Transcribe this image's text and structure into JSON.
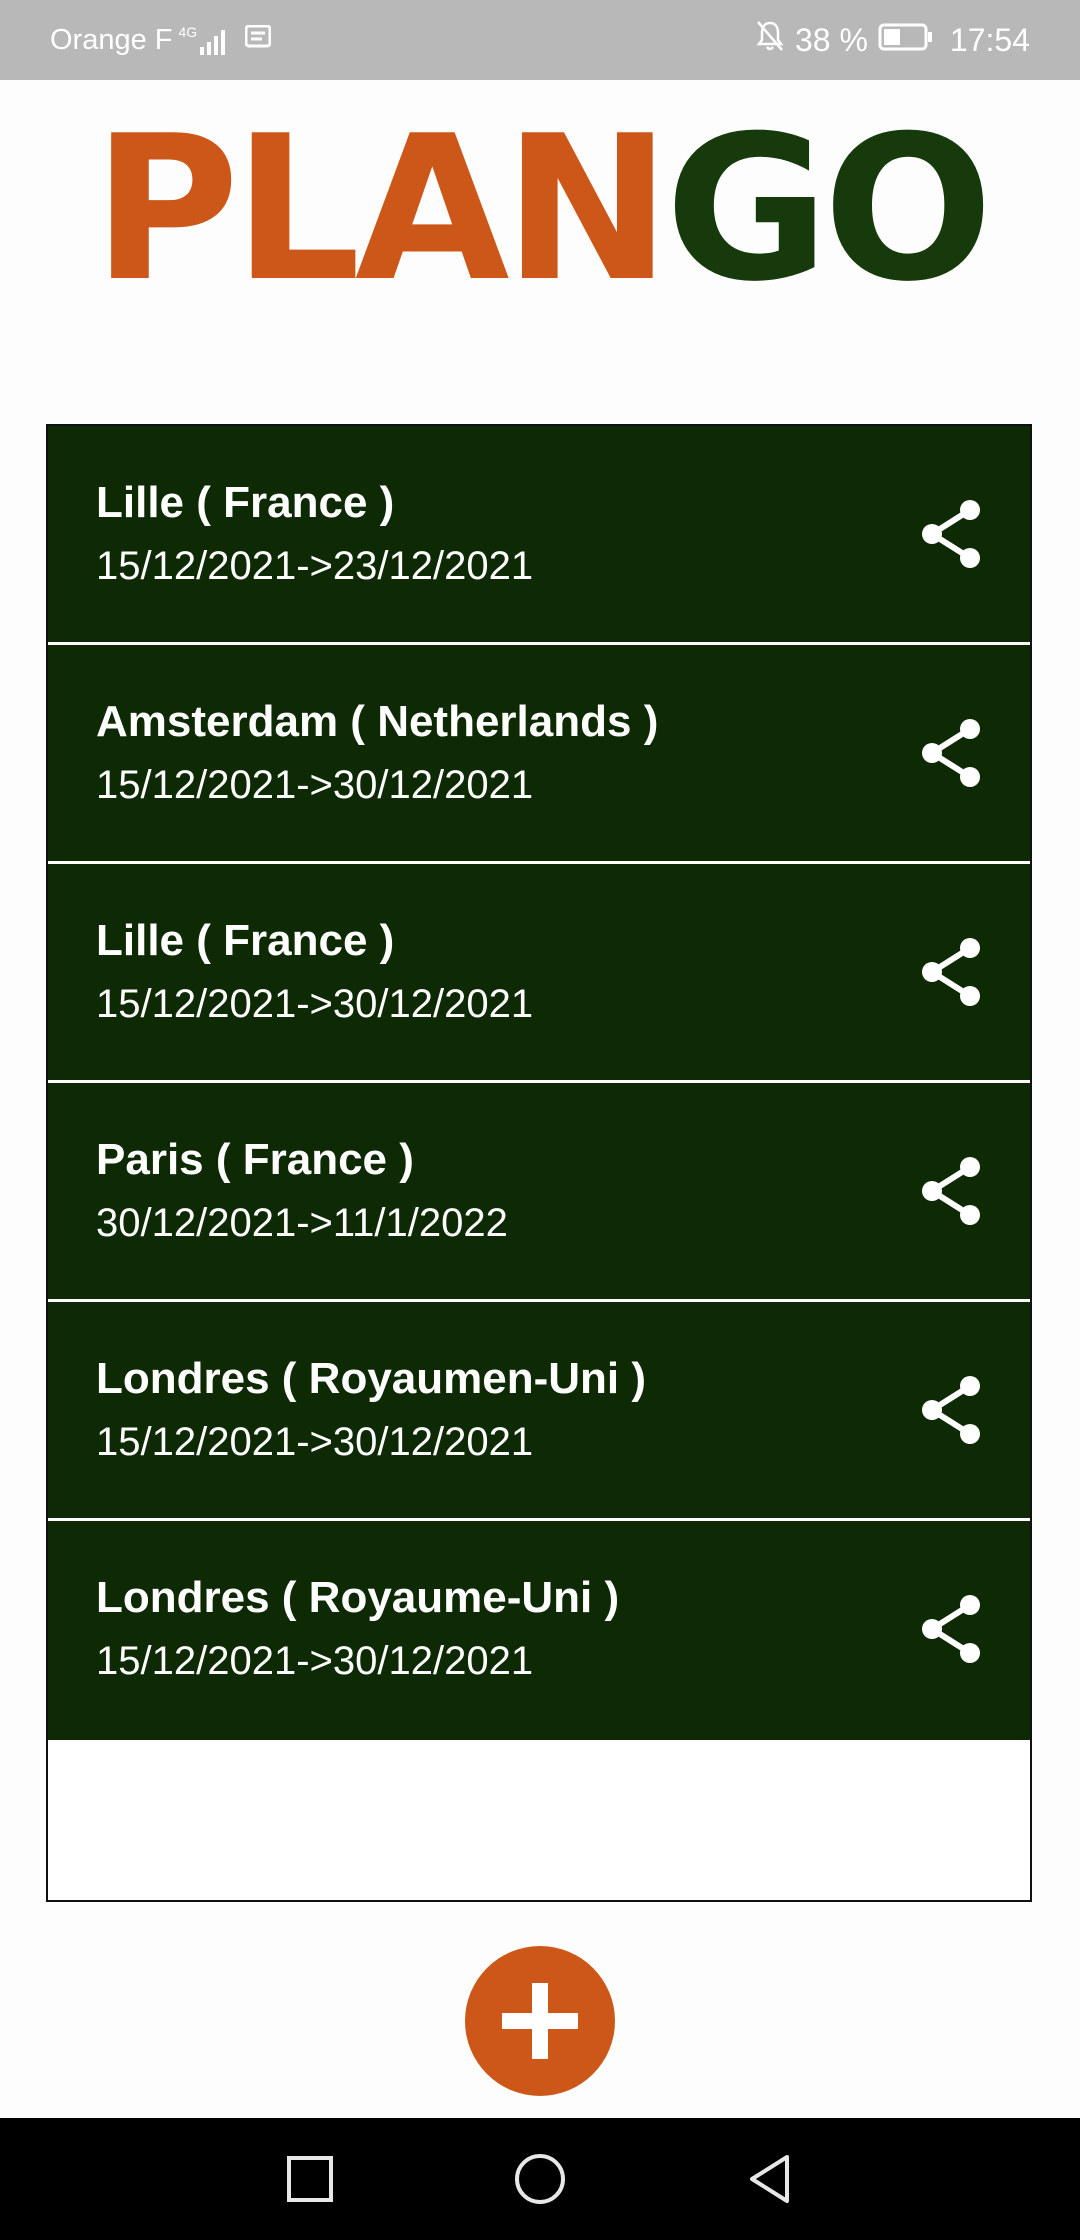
{
  "status_bar": {
    "carrier": "Orange F",
    "network": "4G",
    "battery": "38 %",
    "time": "17:54"
  },
  "app": {
    "logo_part1": "PLAN",
    "logo_part2": "GO",
    "brand_orange": "#cd5718",
    "brand_green": "#173a0c"
  },
  "trips": [
    {
      "city": "Lille ( France )",
      "dates": "15/12/2021->23/12/2021"
    },
    {
      "city": "Amsterdam ( Netherlands )",
      "dates": "15/12/2021->30/12/2021"
    },
    {
      "city": "Lille ( France )",
      "dates": "15/12/2021->30/12/2021"
    },
    {
      "city": "Paris ( France )",
      "dates": "30/12/2021->11/1/2022"
    },
    {
      "city": "Londres ( Royaumen-Uni )",
      "dates": "15/12/2021->30/12/2021"
    },
    {
      "city": "Londres ( Royaume-Uni )",
      "dates": "15/12/2021->30/12/2021"
    }
  ],
  "icons": {
    "share": "share-icon",
    "add": "plus-icon",
    "nav_recents": "square-icon",
    "nav_home": "circle-icon",
    "nav_back": "triangle-back-icon"
  }
}
